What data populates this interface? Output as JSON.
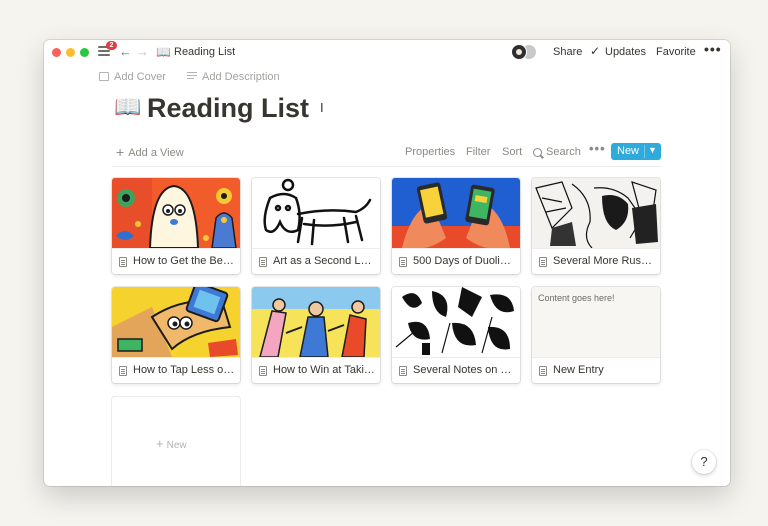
{
  "window": {
    "notification_count": "2",
    "breadcrumb_icon": "📖",
    "breadcrumb": "Reading List",
    "share_label": "Share",
    "updates_label": "Updates",
    "favorite_label": "Favorite",
    "more_label": "•••"
  },
  "page": {
    "add_cover": "Add Cover",
    "add_description": "Add Description",
    "icon": "📖",
    "title": "Reading List"
  },
  "toolbar": {
    "add_view": "Add a View",
    "properties": "Properties",
    "filter": "Filter",
    "sort": "Sort",
    "search": "Search",
    "more": "•••",
    "new_label": "New"
  },
  "gallery": {
    "cards": [
      {
        "title": "How to Get the Be…",
        "cover": "illustration-ghost-character"
      },
      {
        "title": "Art as a Second La…",
        "cover": "illustration-dog-drawing"
      },
      {
        "title": "500 Days of Duoli…",
        "cover": "illustration-phones-in-hands"
      },
      {
        "title": "Several More Russ…",
        "cover": "illustration-ink-sketch"
      },
      {
        "title": "How to Tap Less o…",
        "cover": "illustration-phone-hand-yellow"
      },
      {
        "title": "How to Win at Taki…",
        "cover": "illustration-people-crowd"
      },
      {
        "title": "Several Notes on …",
        "cover": "illustration-black-white-leaves"
      },
      {
        "title": "New Entry",
        "preview_text": "Content goes here!"
      }
    ],
    "new_card_label": "New"
  },
  "help_label": "?",
  "colors": {
    "accent": "#2eaadc",
    "notification_badge": "#e03e3e",
    "text": "#37352f",
    "muted_text": "#8c8a85"
  }
}
